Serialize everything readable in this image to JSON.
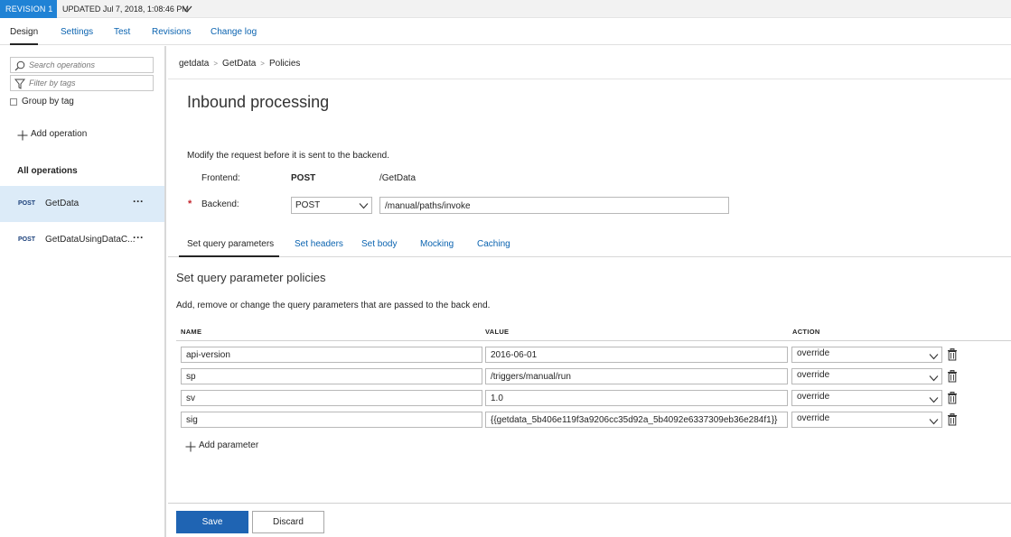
{
  "revision": {
    "badge": "REVISION 1",
    "updated": "UPDATED Jul 7, 2018, 1:08:46 PM"
  },
  "top_tabs": [
    "Design",
    "Settings",
    "Test",
    "Revisions",
    "Change log"
  ],
  "sidebar": {
    "search_placeholder": "Search operations",
    "filter_placeholder": "Filter by tags",
    "group_by_tag": "Group by tag",
    "add_operation": "Add operation",
    "all_operations": "All operations",
    "operations": [
      {
        "method": "POST",
        "name": "GetData",
        "more": "···"
      },
      {
        "method": "POST",
        "name": "GetDataUsingDataC...",
        "more": "···"
      }
    ]
  },
  "breadcrumb": [
    "getdata",
    "GetData",
    "Policies"
  ],
  "breadcrumb_sep": ">",
  "inbound": {
    "title": "Inbound processing",
    "description": "Modify the request before it is sent to the backend.",
    "frontend_label": "Frontend:",
    "frontend_method": "POST",
    "frontend_path": "/GetData",
    "required_mark": "*",
    "backend_label": "Backend:",
    "backend_method": "POST",
    "backend_url": "/manual/paths/invoke"
  },
  "policy_tabs": [
    "Set query parameters",
    "Set headers",
    "Set body",
    "Mocking",
    "Caching"
  ],
  "query_params": {
    "title": "Set query parameter policies",
    "description": "Add, remove or change the query parameters that are passed to the back end.",
    "columns": [
      "NAME",
      "VALUE",
      "ACTION"
    ],
    "rows": [
      {
        "name": "api-version",
        "value": "2016-06-01",
        "action": "override"
      },
      {
        "name": "sp",
        "value": "/triggers/manual/run",
        "action": "override"
      },
      {
        "name": "sv",
        "value": "1.0",
        "action": "override"
      },
      {
        "name": "sig",
        "value": "{{getdata_5b406e119f3a9206cc35d92a_5b4092e6337309eb36e284f1}}",
        "action": "override"
      }
    ],
    "add_label": "Add parameter"
  },
  "footer": {
    "save": "Save",
    "discard": "Discard"
  },
  "colors": {
    "accent": "#1f82d5",
    "link": "#0a63b0",
    "save_button": "#1f64b3",
    "selected_row": "#dcebf8",
    "required": "#c4262e"
  }
}
